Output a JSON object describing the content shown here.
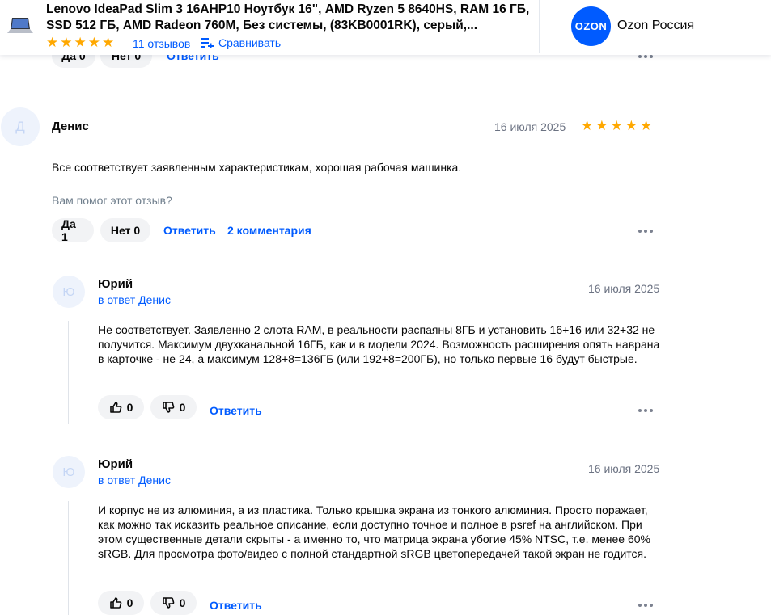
{
  "header": {
    "product_title": "Lenovo IdeaPad Slim 3 16AHP10 Ноутбук 16\", AMD Ryzen 5 8640HS, RAM 16 ГБ, SSD 512 ГБ, AMD Radeon 760M, Без системы, (83KB0001RK), серый,...",
    "rating_stars": 5,
    "reviews_count_label": "11 отзывов",
    "compare_label": "Сравнивать",
    "store_logo_text": "OZON",
    "store_name": "Ozon Россия"
  },
  "previous_review_actions": {
    "yes_label": "Да 0",
    "no_label": "Нет 0",
    "reply_label": "Ответить"
  },
  "review": {
    "avatar_letter": "Д",
    "author": "Денис",
    "date": "16 июля 2025",
    "rating": 5,
    "text": "Все соответствует заявленным характеристикам, хорошая рабочая машинка.",
    "helpful_question": "Вам помог этот отзыв?",
    "yes_label": "Да 1",
    "no_label": "Нет 0",
    "reply_label": "Ответить",
    "comments_label": "2 комментария"
  },
  "comments": [
    {
      "avatar_letter": "Ю",
      "author": "Юрий",
      "reply_to": "в ответ Денис",
      "date": "16 июля 2025",
      "text": "Не соответствует. Заявленно 2 слота RAM, в реальности распаяны 8ГБ и установить 16+16 или 32+32 не получится. Максимум двухканальной 16ГБ, как и в модели 2024. Возможность расширения опять наврана в карточке - не 24, а максимум 128+8=136ГБ (или 192+8=200ГБ), но только первые 16 будут быстрые.",
      "likes": "0",
      "dislikes": "0",
      "reply_label": "Ответить"
    },
    {
      "avatar_letter": "Ю",
      "author": "Юрий",
      "reply_to": "в ответ Денис",
      "date": "16 июля 2025",
      "text": "И корпус не из алюминия, а из пластика. Только крышка экрана из тонкого алюминия. Просто поражает, как можно так исказить реальное описание, если доступно точное и полное в psref на английском. При этом существенные детали скрыты - а именно то, что матрица экрана убогие 45% NTSC, т.е. менее 60% sRGB. Для просмотра фото/видео с полной стандартной sRGB цветопередачей такой экран не годится.",
      "likes": "0",
      "dislikes": "0",
      "reply_label": "Ответить"
    }
  ],
  "colors": {
    "accent": "#005bff",
    "star": "#ffa800",
    "pill_bg": "#f2f3f5",
    "muted_text": "#707f8d"
  }
}
